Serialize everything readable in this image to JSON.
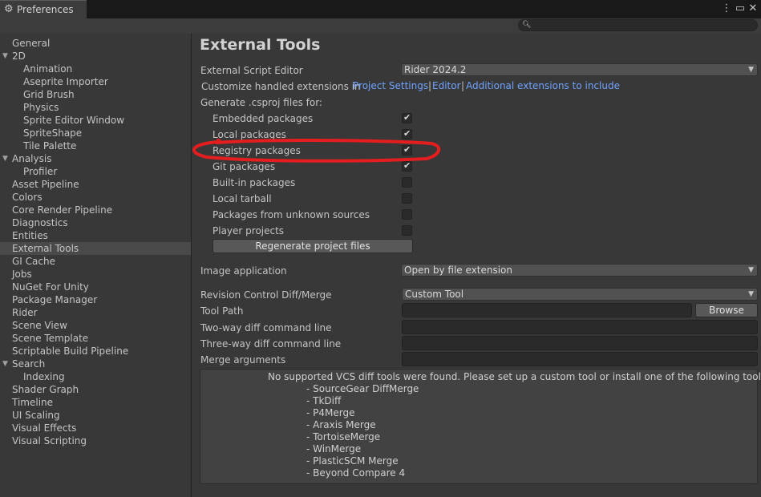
{
  "window": {
    "tab_title": "Preferences",
    "tab_icon": "gear-icon",
    "controls": [
      "more-icon",
      "maximize-icon",
      "close-icon"
    ]
  },
  "search": {
    "placeholder": "",
    "value": ""
  },
  "sidebar": {
    "selected": "External Tools",
    "items": [
      {
        "label": "General",
        "indent": 0
      },
      {
        "label": "2D",
        "indent": 0,
        "expanded": true
      },
      {
        "label": "Animation",
        "indent": 1
      },
      {
        "label": "Aseprite Importer",
        "indent": 1
      },
      {
        "label": "Grid Brush",
        "indent": 1
      },
      {
        "label": "Physics",
        "indent": 1
      },
      {
        "label": "Sprite Editor Window",
        "indent": 1
      },
      {
        "label": "SpriteShape",
        "indent": 1
      },
      {
        "label": "Tile Palette",
        "indent": 1
      },
      {
        "label": "Analysis",
        "indent": 0,
        "expanded": true
      },
      {
        "label": "Profiler",
        "indent": 1
      },
      {
        "label": "Asset Pipeline",
        "indent": 0
      },
      {
        "label": "Colors",
        "indent": 0
      },
      {
        "label": "Core Render Pipeline",
        "indent": 0
      },
      {
        "label": "Diagnostics",
        "indent": 0
      },
      {
        "label": "Entities",
        "indent": 0
      },
      {
        "label": "External Tools",
        "indent": 0
      },
      {
        "label": "GI Cache",
        "indent": 0
      },
      {
        "label": "Jobs",
        "indent": 0
      },
      {
        "label": "NuGet For Unity",
        "indent": 0
      },
      {
        "label": "Package Manager",
        "indent": 0
      },
      {
        "label": "Rider",
        "indent": 0
      },
      {
        "label": "Scene View",
        "indent": 0
      },
      {
        "label": "Scene Template",
        "indent": 0
      },
      {
        "label": "Scriptable Build Pipeline",
        "indent": 0
      },
      {
        "label": "Search",
        "indent": 0,
        "expanded": true
      },
      {
        "label": "Indexing",
        "indent": 1
      },
      {
        "label": "Shader Graph",
        "indent": 0
      },
      {
        "label": "Timeline",
        "indent": 0
      },
      {
        "label": "UI Scaling",
        "indent": 0
      },
      {
        "label": "Visual Effects",
        "indent": 0
      },
      {
        "label": "Visual Scripting",
        "indent": 0
      }
    ]
  },
  "main": {
    "title": "External Tools",
    "script_editor": {
      "label": "External Script Editor",
      "value": "Rider 2024.2"
    },
    "extensions": {
      "prefix": "Customize handled extensions in",
      "link1": "Project Settings",
      "sep1": "|",
      "link2": "Editor",
      "sep2": "|",
      "link3": "Additional extensions to include"
    },
    "csproj": {
      "heading": "Generate .csproj files for:",
      "options": [
        {
          "label": "Embedded packages",
          "checked": true
        },
        {
          "label": "Local packages",
          "checked": true
        },
        {
          "label": "Registry packages",
          "checked": true
        },
        {
          "label": "Git packages",
          "checked": true
        },
        {
          "label": "Built-in packages",
          "checked": false
        },
        {
          "label": "Local tarball",
          "checked": false
        },
        {
          "label": "Packages from unknown sources",
          "checked": false
        },
        {
          "label": "Player projects",
          "checked": false
        }
      ],
      "regenerate_label": "Regenerate project files"
    },
    "image_app": {
      "label": "Image application",
      "value": "Open by file extension"
    },
    "revision": {
      "label": "Revision Control Diff/Merge",
      "value": "Custom Tool"
    },
    "tool_path": {
      "label": "Tool Path",
      "value": "",
      "browse_label": "Browse"
    },
    "two_way": {
      "label": "Two-way diff command line",
      "value": ""
    },
    "three_way": {
      "label": "Three-way diff command line",
      "value": ""
    },
    "merge_args": {
      "label": "Merge arguments",
      "value": ""
    },
    "help": {
      "message": "No supported VCS diff tools were found. Please set up a custom tool or install one of the following tools:",
      "tools": [
        "- SourceGear DiffMerge",
        "- TkDiff",
        "- P4Merge",
        "- Araxis Merge",
        "- TortoiseMerge",
        "- WinMerge",
        "- PlasticSCM Merge",
        "- Beyond Compare 4"
      ]
    }
  },
  "annotation": {
    "color": "#e41e1e"
  }
}
